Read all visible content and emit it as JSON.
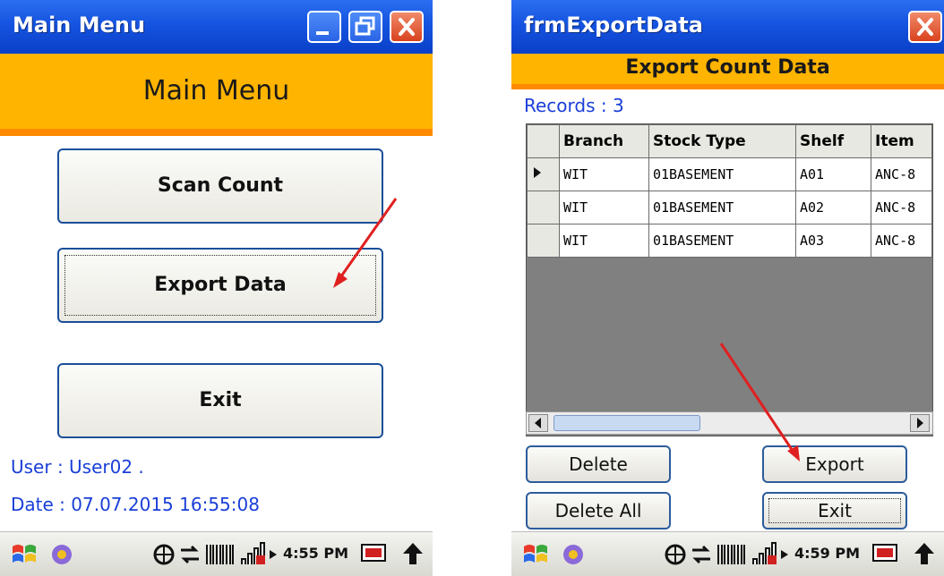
{
  "left": {
    "window_title": "Main Menu",
    "banner": "Main Menu",
    "buttons": {
      "scan_count": "Scan Count",
      "export_data": "Export Data",
      "exit": "Exit"
    },
    "user_line": "User : User02 .",
    "date_line": "Date : 07.07.2015 16:55:08",
    "taskbar_clock": "4:55 PM"
  },
  "right": {
    "window_title": "frmExportData",
    "banner": "Export Count Data",
    "records_label": "Records : 3",
    "columns": [
      "Branch",
      "Stock Type",
      "Shelf",
      "Item"
    ],
    "rows": [
      [
        "WIT",
        "01BASEMENT",
        "A01",
        "ANC-8"
      ],
      [
        "WIT",
        "01BASEMENT",
        "A02",
        "ANC-8"
      ],
      [
        "WIT",
        "01BASEMENT",
        "A03",
        "ANC-8"
      ]
    ],
    "buttons": {
      "delete": "Delete",
      "export": "Export",
      "delete_all": "Delete All",
      "exit": "Exit"
    },
    "taskbar_clock": "4:59 PM"
  },
  "colors": {
    "titlebar_blue": "#1554e0",
    "banner_orange": "#ffb400",
    "info_text_blue": "#1a3fd8",
    "annotation_arrow": "#e02020"
  }
}
